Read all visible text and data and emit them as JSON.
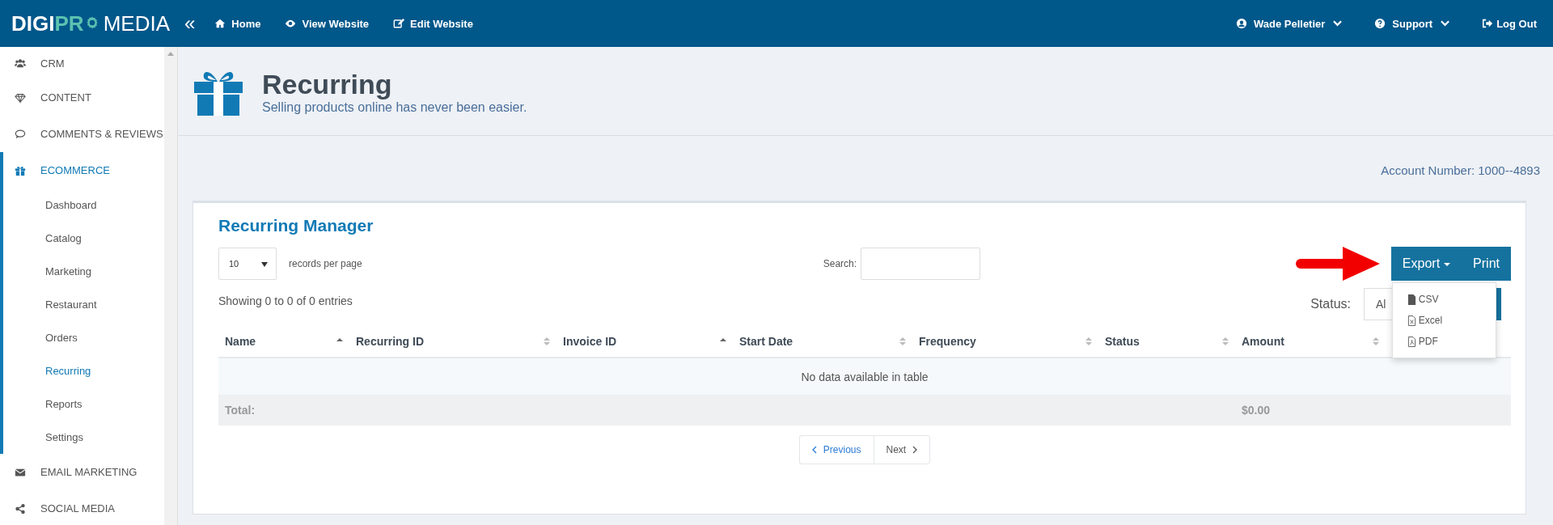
{
  "topbar": {
    "logo": {
      "part1": "DIGI",
      "part2": "PR",
      "part3": "MEDIA"
    },
    "collapse": "«",
    "links": [
      {
        "label": "Home"
      },
      {
        "label": "View Website"
      },
      {
        "label": "Edit Website"
      }
    ],
    "right": [
      {
        "label": "Wade Pelletier",
        "dropdown": true
      },
      {
        "label": "Support",
        "dropdown": true
      },
      {
        "label": "Log Out",
        "dropdown": false
      }
    ]
  },
  "sidebar": {
    "items": [
      {
        "label": "CRM",
        "expanded": false,
        "selected": false
      },
      {
        "label": "CONTENT",
        "expanded": false,
        "selected": false
      },
      {
        "label": "COMMENTS & REVIEWS",
        "expanded": false,
        "selected": false
      },
      {
        "label": "ECOMMERCE",
        "expanded": true,
        "selected": true,
        "children": [
          {
            "label": "Dashboard",
            "selected": false
          },
          {
            "label": "Catalog",
            "selected": false
          },
          {
            "label": "Marketing",
            "selected": false
          },
          {
            "label": "Restaurant",
            "selected": false
          },
          {
            "label": "Orders",
            "selected": false
          },
          {
            "label": "Recurring",
            "selected": true
          },
          {
            "label": "Reports",
            "selected": false
          },
          {
            "label": "Settings",
            "selected": false
          }
        ]
      },
      {
        "label": "EMAIL MARKETING",
        "expanded": false,
        "selected": false
      },
      {
        "label": "SOCIAL MEDIA",
        "expanded": false,
        "selected": false
      }
    ]
  },
  "header": {
    "title": "Recurring",
    "subtitle": "Selling products online has never been easier."
  },
  "account": "Account Number: 1000--4893",
  "card": {
    "title": "Recurring Manager",
    "page_size": "10",
    "page_size_label": "records per page",
    "search_label": "Search:",
    "export": "Export",
    "print": "Print",
    "export_menu": [
      {
        "label": "CSV"
      },
      {
        "label": "Excel"
      },
      {
        "label": "PDF"
      }
    ],
    "status_label": "Status:",
    "status_value": "Al",
    "info": "Showing 0 to 0 of 0 entries",
    "columns": [
      {
        "label": "Name",
        "sorted": true
      },
      {
        "label": "Recurring ID",
        "sorted": false
      },
      {
        "label": "Invoice ID",
        "sorted": true
      },
      {
        "label": "Start Date",
        "sorted": false
      },
      {
        "label": "Frequency",
        "sorted": false
      },
      {
        "label": "Status",
        "sorted": false
      },
      {
        "label": "Amount",
        "sorted": false
      }
    ],
    "empty": "No data available in table",
    "footer": {
      "label": "Total:",
      "amount": "$0.00"
    },
    "pagination": {
      "previous": "Previous",
      "next": "Next",
      "previous_disabled": false
    }
  }
}
